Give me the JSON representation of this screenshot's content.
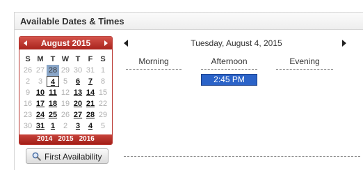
{
  "header": {
    "title": "Available Dates & Times"
  },
  "calendar": {
    "month_label": "August 2015",
    "weekdays": [
      "S",
      "M",
      "T",
      "W",
      "T",
      "F",
      "S"
    ],
    "weeks": [
      [
        {
          "d": "26",
          "s": "other"
        },
        {
          "d": "27",
          "s": "other"
        },
        {
          "d": "28",
          "s": "today"
        },
        {
          "d": "29",
          "s": "other"
        },
        {
          "d": "30",
          "s": "other"
        },
        {
          "d": "31",
          "s": "other"
        },
        {
          "d": "1",
          "s": "na"
        }
      ],
      [
        {
          "d": "2",
          "s": "na"
        },
        {
          "d": "3",
          "s": "na"
        },
        {
          "d": "4",
          "s": "selected"
        },
        {
          "d": "5",
          "s": "na"
        },
        {
          "d": "6",
          "s": "avail"
        },
        {
          "d": "7",
          "s": "avail"
        },
        {
          "d": "8",
          "s": "na"
        }
      ],
      [
        {
          "d": "9",
          "s": "na"
        },
        {
          "d": "10",
          "s": "avail"
        },
        {
          "d": "11",
          "s": "avail"
        },
        {
          "d": "12",
          "s": "na"
        },
        {
          "d": "13",
          "s": "avail"
        },
        {
          "d": "14",
          "s": "avail"
        },
        {
          "d": "15",
          "s": "na"
        }
      ],
      [
        {
          "d": "16",
          "s": "na"
        },
        {
          "d": "17",
          "s": "avail"
        },
        {
          "d": "18",
          "s": "avail"
        },
        {
          "d": "19",
          "s": "na"
        },
        {
          "d": "20",
          "s": "avail"
        },
        {
          "d": "21",
          "s": "avail"
        },
        {
          "d": "22",
          "s": "na"
        }
      ],
      [
        {
          "d": "23",
          "s": "na"
        },
        {
          "d": "24",
          "s": "avail"
        },
        {
          "d": "25",
          "s": "avail"
        },
        {
          "d": "26",
          "s": "na"
        },
        {
          "d": "27",
          "s": "avail"
        },
        {
          "d": "28",
          "s": "avail"
        },
        {
          "d": "29",
          "s": "na"
        }
      ],
      [
        {
          "d": "30",
          "s": "na"
        },
        {
          "d": "31",
          "s": "avail"
        },
        {
          "d": "1",
          "s": "avail"
        },
        {
          "d": "2",
          "s": "other"
        },
        {
          "d": "3",
          "s": "avail"
        },
        {
          "d": "4",
          "s": "avail"
        },
        {
          "d": "5",
          "s": "other"
        }
      ]
    ],
    "years": [
      "2014",
      "2015",
      "2016"
    ]
  },
  "first_availability": {
    "label": "First Availability"
  },
  "day_view": {
    "date_label": "Tuesday, August 4, 2015",
    "columns": [
      "Morning",
      "Afternoon",
      "Evening"
    ],
    "slots": [
      {
        "time": "2:45 PM",
        "column": "Afternoon"
      }
    ]
  },
  "colors": {
    "calendar_header": "#b7312b",
    "today_highlight": "#8aa6c8",
    "slot_fill": "#2b63c8"
  },
  "icons": [
    "chevron-left-icon",
    "chevron-right-icon",
    "magnifier-icon"
  ]
}
